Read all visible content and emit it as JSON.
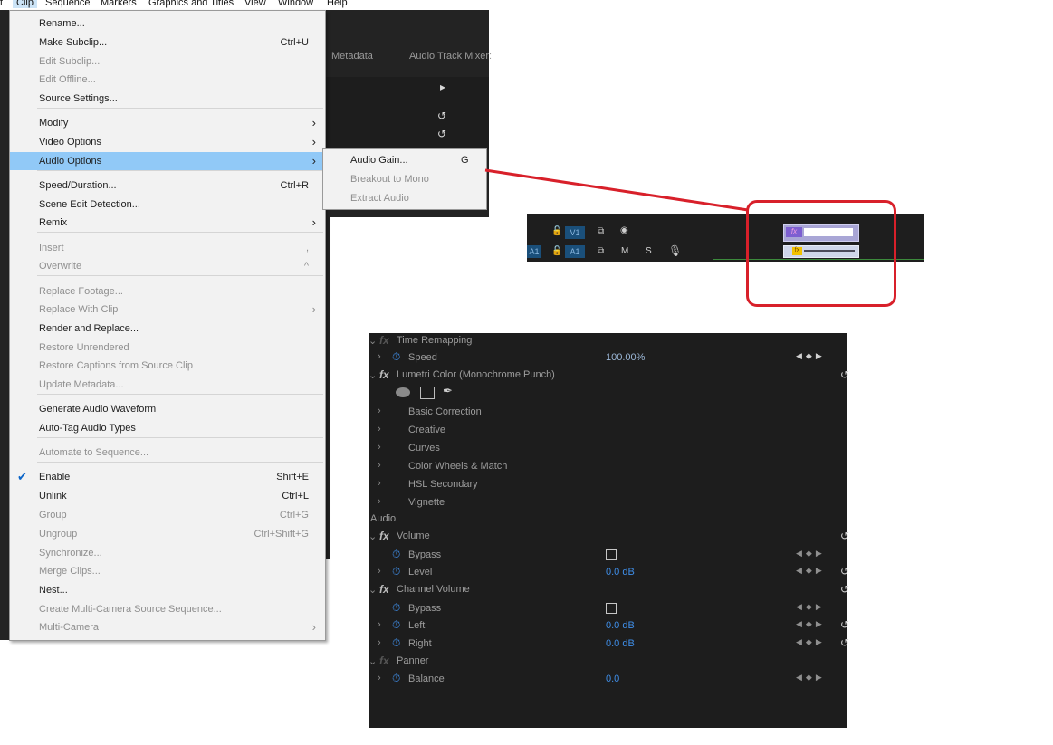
{
  "menubar": {
    "items": [
      "t",
      "Clip",
      "Sequence",
      "Markers",
      "Graphics and Titles",
      "View",
      "Window",
      "Help"
    ]
  },
  "background_panel": {
    "tabs": [
      "Metadata",
      "Audio Track Mixer:"
    ]
  },
  "clip_menu": {
    "items": [
      {
        "label": "Rename...",
        "shortcut": "",
        "enabled": true
      },
      {
        "label": "Make Subclip...",
        "shortcut": "Ctrl+U",
        "enabled": true
      },
      {
        "label": "Edit Subclip...",
        "shortcut": "",
        "enabled": false
      },
      {
        "label": "Edit Offline...",
        "shortcut": "",
        "enabled": false
      },
      {
        "label": "Source Settings...",
        "shortcut": "",
        "enabled": true
      },
      {
        "label": "Modify",
        "shortcut": "",
        "enabled": true,
        "submenu": true
      },
      {
        "label": "Video Options",
        "shortcut": "",
        "enabled": true,
        "submenu": true
      },
      {
        "label": "Audio Options",
        "shortcut": "",
        "enabled": true,
        "submenu": true,
        "highlighted": true
      },
      {
        "label": "Speed/Duration...",
        "shortcut": "Ctrl+R",
        "enabled": true
      },
      {
        "label": "Scene Edit Detection...",
        "shortcut": "",
        "enabled": true
      },
      {
        "label": "Remix",
        "shortcut": "",
        "enabled": true,
        "submenu": true
      },
      {
        "label": "Insert",
        "shortcut": ",",
        "enabled": false
      },
      {
        "label": "Overwrite",
        "shortcut": "^",
        "enabled": false
      },
      {
        "label": "Replace Footage...",
        "shortcut": "",
        "enabled": false
      },
      {
        "label": "Replace With Clip",
        "shortcut": "",
        "enabled": false,
        "submenu": true
      },
      {
        "label": "Render and Replace...",
        "shortcut": "",
        "enabled": true
      },
      {
        "label": "Restore Unrendered",
        "shortcut": "",
        "enabled": false
      },
      {
        "label": "Restore Captions from Source Clip",
        "shortcut": "",
        "enabled": false
      },
      {
        "label": "Update Metadata...",
        "shortcut": "",
        "enabled": false
      },
      {
        "label": "Generate Audio Waveform",
        "shortcut": "",
        "enabled": true
      },
      {
        "label": "Auto-Tag Audio Types",
        "shortcut": "",
        "enabled": true
      },
      {
        "label": "Automate to Sequence...",
        "shortcut": "",
        "enabled": false
      },
      {
        "label": "Enable",
        "shortcut": "Shift+E",
        "enabled": true,
        "checked": true
      },
      {
        "label": "Unlink",
        "shortcut": "Ctrl+L",
        "enabled": true
      },
      {
        "label": "Group",
        "shortcut": "Ctrl+G",
        "enabled": false
      },
      {
        "label": "Ungroup",
        "shortcut": "Ctrl+Shift+G",
        "enabled": false
      },
      {
        "label": "Synchronize...",
        "shortcut": "",
        "enabled": false
      },
      {
        "label": "Merge Clips...",
        "shortcut": "",
        "enabled": false
      },
      {
        "label": "Nest...",
        "shortcut": "",
        "enabled": true
      },
      {
        "label": "Create Multi-Camera Source Sequence...",
        "shortcut": "",
        "enabled": false
      },
      {
        "label": "Multi-Camera",
        "shortcut": "",
        "enabled": false,
        "submenu": true
      }
    ]
  },
  "audio_options_submenu": {
    "items": [
      {
        "label": "Audio Gain...",
        "shortcut": "G",
        "enabled": true
      },
      {
        "label": "Breakout to Mono",
        "shortcut": "",
        "enabled": false
      },
      {
        "label": "Extract Audio",
        "shortcut": "",
        "enabled": false
      }
    ]
  },
  "timeline": {
    "video_track": {
      "source": "",
      "name": "V1"
    },
    "audio_track": {
      "source": "A1",
      "name": "A1",
      "mute": "M",
      "solo": "S"
    },
    "callout_color": "#d8202a"
  },
  "effect_controls": {
    "time_remapping": "Time Remapping",
    "speed_label": "Speed",
    "speed_value": "100.00%",
    "lumetri": "Lumetri Color (Monochrome Punch)",
    "lumetri_sections": [
      "Basic Correction",
      "Creative",
      "Curves",
      "Color Wheels & Match",
      "HSL Secondary",
      "Vignette"
    ],
    "audio_header": "Audio",
    "volume": "Volume",
    "bypass": "Bypass",
    "level": "Level",
    "level_value": "0.0 dB",
    "channel_volume": "Channel Volume",
    "left": "Left",
    "left_value": "0.0 dB",
    "right": "Right",
    "right_value": "0.0 dB",
    "panner": "Panner",
    "balance": "Balance",
    "balance_value": "0.0"
  }
}
